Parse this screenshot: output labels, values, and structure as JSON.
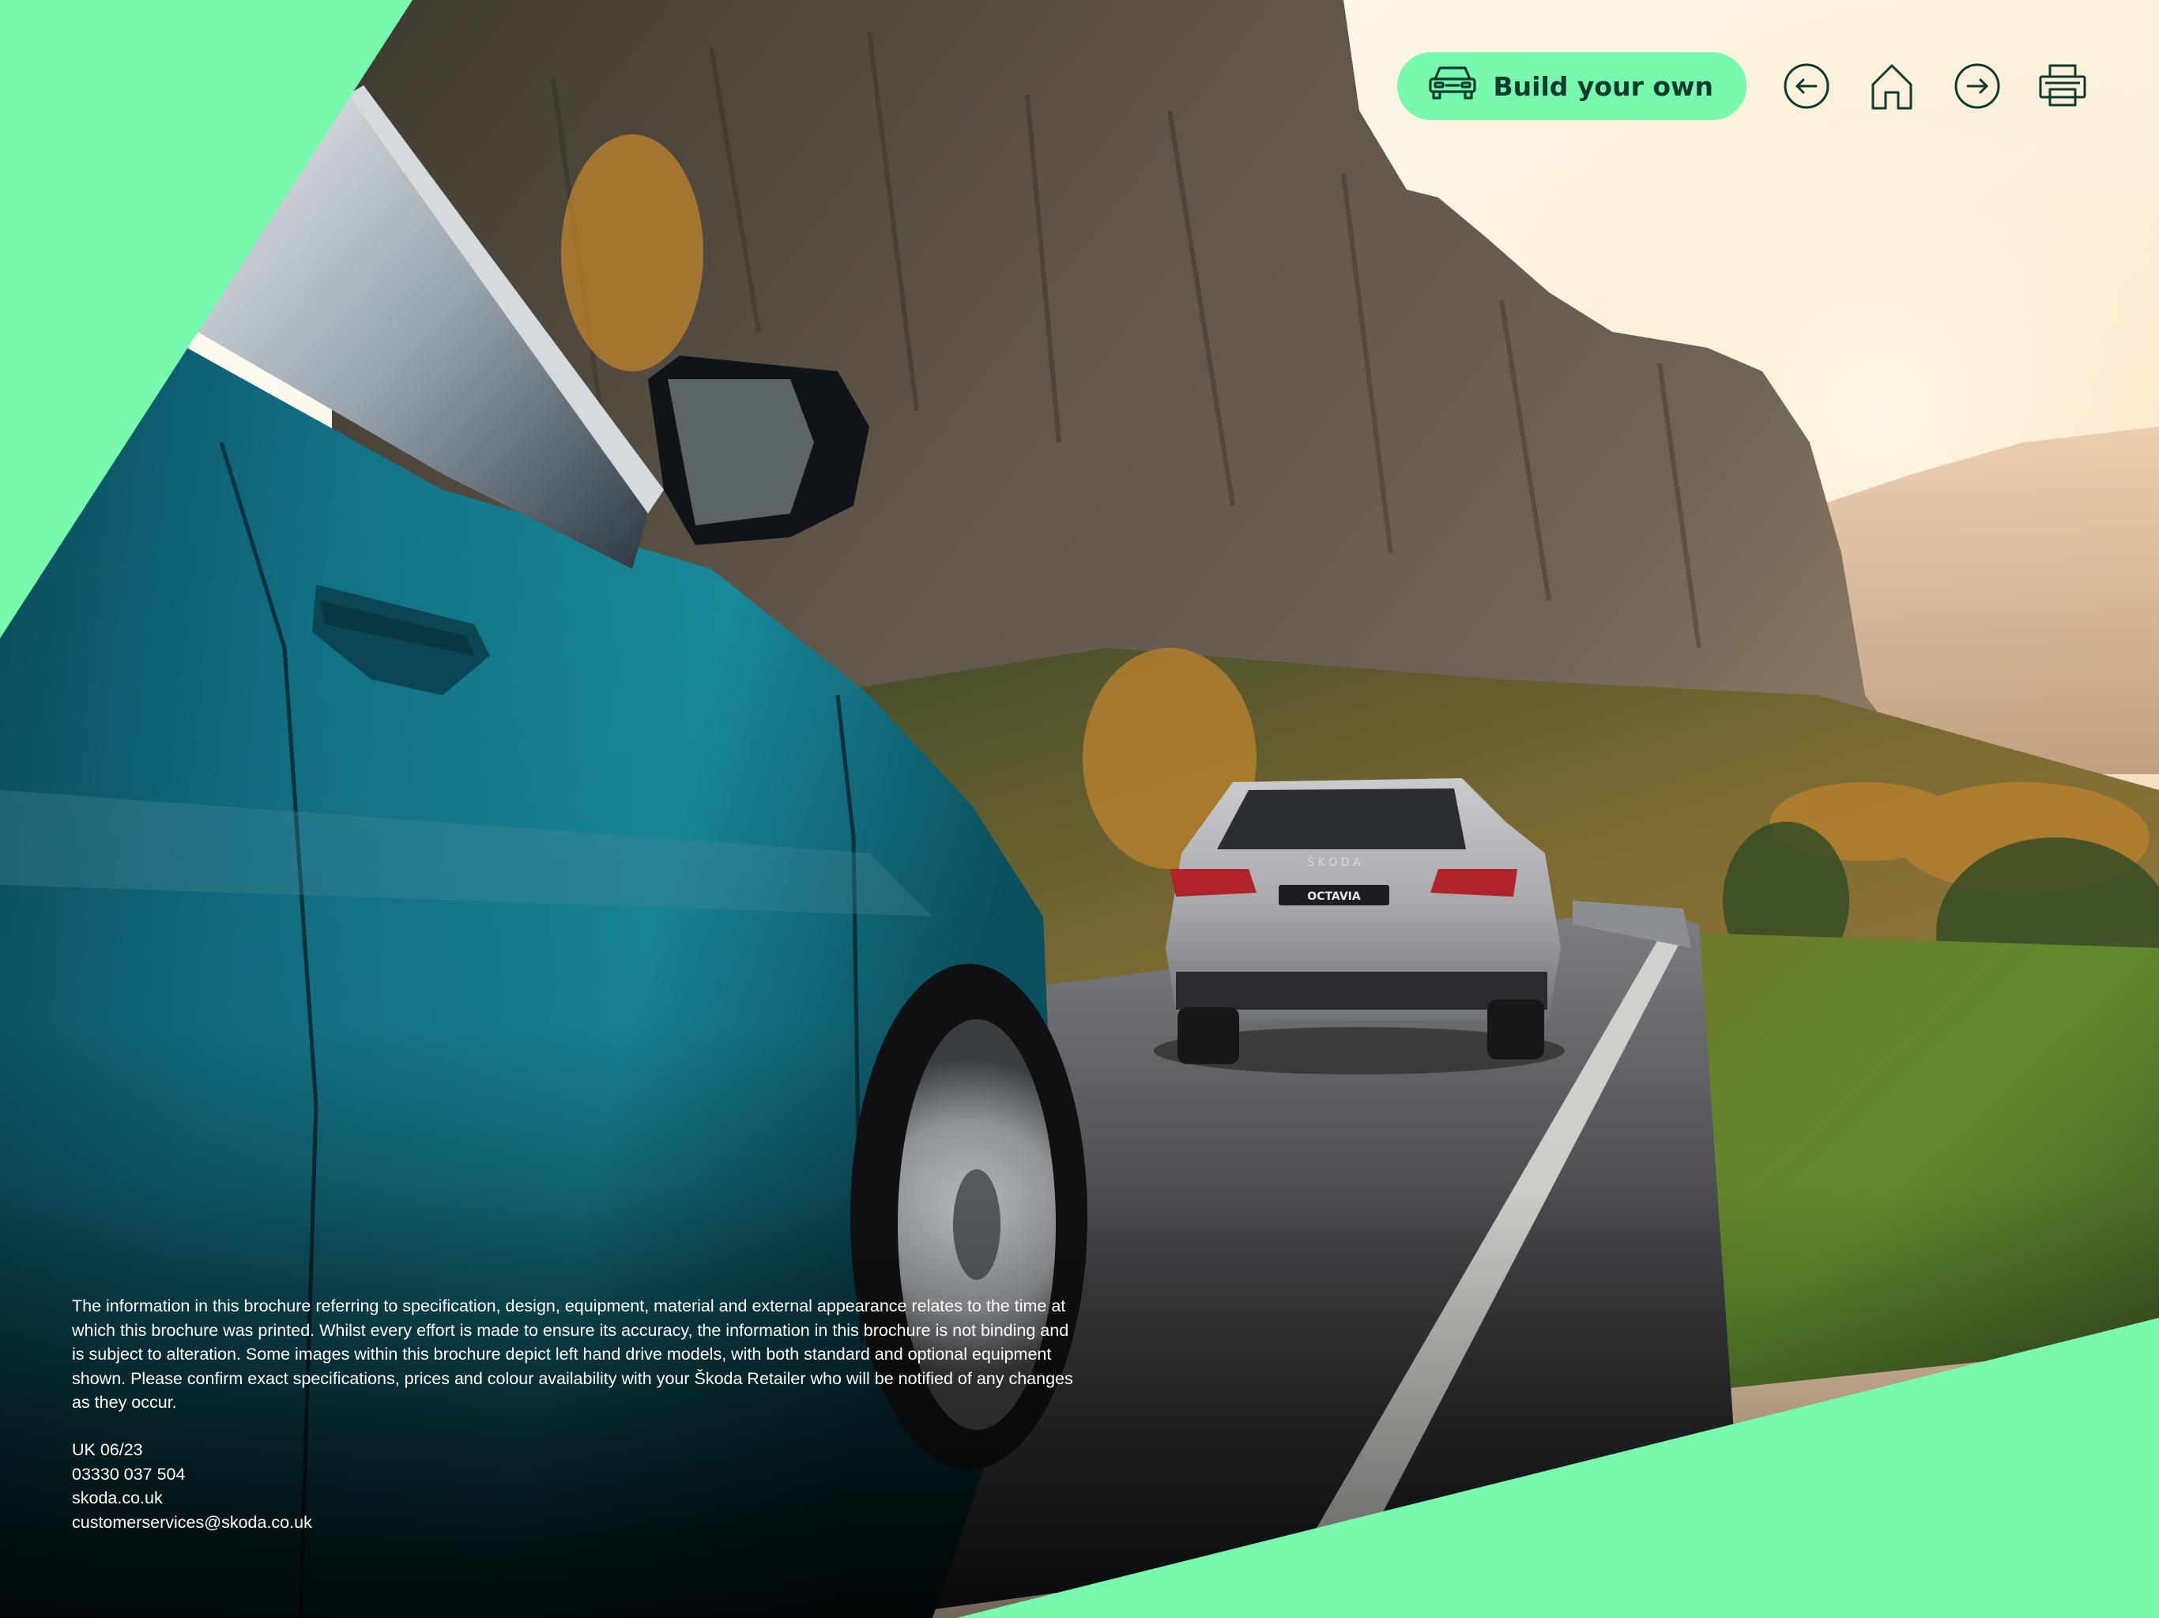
{
  "toolbar": {
    "build_label": "Build your own",
    "build_icon": "car-front-icon",
    "back_icon": "arrow-left-circle-icon",
    "home_icon": "home-icon",
    "forward_icon": "arrow-right-circle-icon",
    "print_icon": "printer-icon"
  },
  "hero": {
    "badge_text": "OCTAVIA",
    "trunk_lettering": "Š K O D A"
  },
  "disclaimer": {
    "text": "The information in this brochure referring to specification, design, equipment, material and external appearance relates to the time at which this brochure was printed. Whilst every effort is made to ensure its accuracy, the information in this brochure is not binding and is subject to alteration. Some images within this brochure depict left hand drive models, with both standard and optional equipment shown. Please confirm exact specifications, prices and colour availability with your Škoda Retailer who will be notified of any changes as they occur."
  },
  "contact": {
    "edition": "UK 06/23",
    "phone": "03330 037 504",
    "website": "skoda.co.uk",
    "email": "customerservices@skoda.co.uk"
  },
  "colors": {
    "accent": "#78faae",
    "icon_stroke": "#0e3a2f",
    "car_teal": "#13768a",
    "car_silver": "#a8aaae"
  }
}
